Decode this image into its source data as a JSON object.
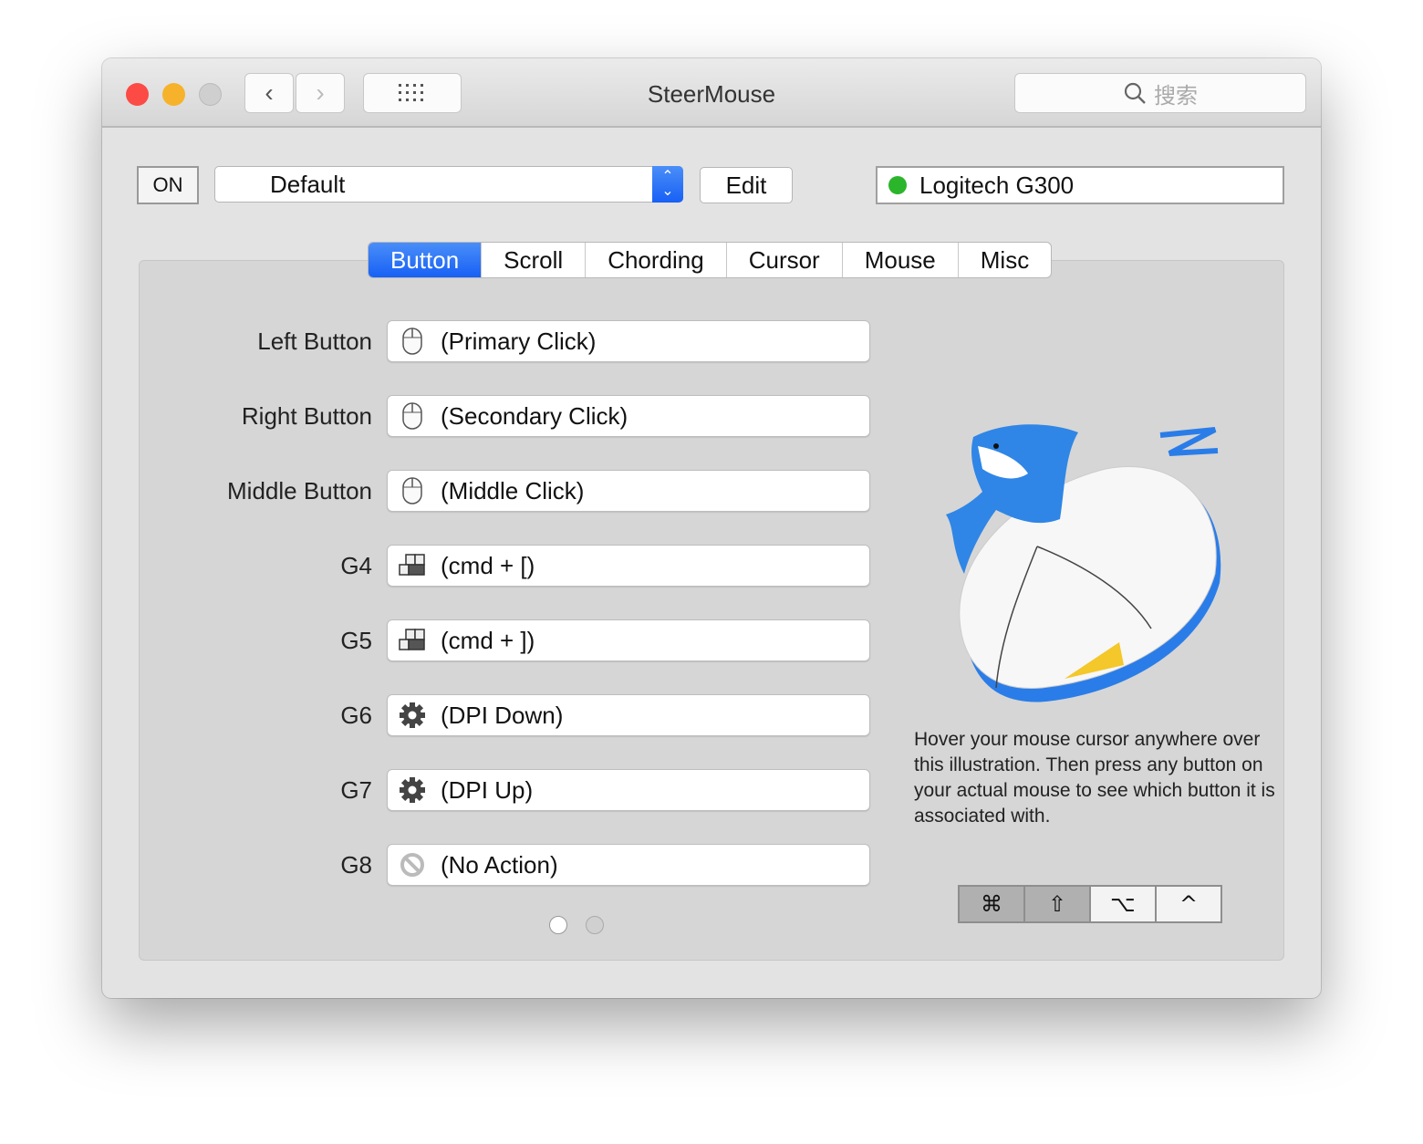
{
  "window": {
    "title": "SteerMouse",
    "search_placeholder": "搜索"
  },
  "toolbar": {
    "on_label": "ON",
    "profile": "Default",
    "edit_label": "Edit",
    "device": "Logitech G300",
    "device_status_color": "#2bb52b"
  },
  "tabs": [
    {
      "label": "Button",
      "active": true
    },
    {
      "label": "Scroll"
    },
    {
      "label": "Chording"
    },
    {
      "label": "Cursor"
    },
    {
      "label": "Mouse"
    },
    {
      "label": "Misc"
    }
  ],
  "buttons": [
    {
      "label": "Left Button",
      "action": "(Primary Click)",
      "icon": "mouse-icon"
    },
    {
      "label": "Right Button",
      "action": "(Secondary Click)",
      "icon": "mouse-icon"
    },
    {
      "label": "Middle Button",
      "action": "(Middle Click)",
      "icon": "mouse-icon"
    },
    {
      "label": "G4",
      "action": "(cmd + [)",
      "icon": "keyboard-icon"
    },
    {
      "label": "G5",
      "action": "(cmd + ])",
      "icon": "keyboard-icon"
    },
    {
      "label": "G6",
      "action": "(DPI Down)",
      "icon": "gear-icon"
    },
    {
      "label": "G7",
      "action": "(DPI Up)",
      "icon": "gear-icon"
    },
    {
      "label": "G8",
      "action": "(No Action)",
      "icon": "no-action-icon"
    }
  ],
  "pages": {
    "current": 1,
    "total": 2
  },
  "hint": "Hover your mouse cursor anywhere over this illustration. Then press any button on your actual mouse to see which button it is associated with.",
  "modifiers": [
    {
      "symbol": "⌘",
      "pressed": true
    },
    {
      "symbol": "⇧",
      "pressed": true
    },
    {
      "symbol": "⌥",
      "pressed": false
    },
    {
      "symbol": "^",
      "pressed": false
    }
  ],
  "colors": {
    "accent": "#1760f5"
  }
}
